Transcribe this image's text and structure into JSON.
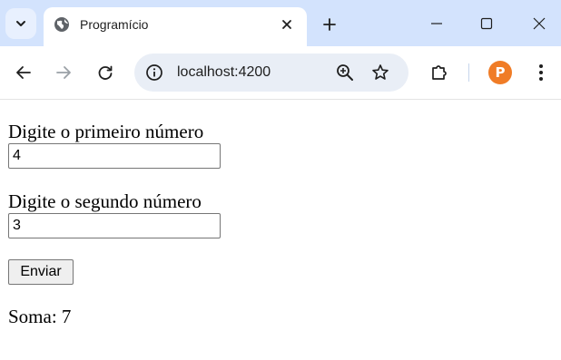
{
  "browser": {
    "tab": {
      "title": "Programício",
      "favicon": "globe-icon"
    },
    "address_bar": {
      "url": "localhost:4200"
    },
    "profile_avatar_letter": "P",
    "colors": {
      "tabstrip": "#d3e3fd",
      "omnibox": "#e9eef6",
      "avatar": "#f07c26"
    }
  },
  "form": {
    "first": {
      "label": "Digite o primeiro número",
      "value": "4"
    },
    "second": {
      "label": "Digite o segundo número",
      "value": "3"
    },
    "submit_label": "Enviar",
    "result_label": "Soma:",
    "result_value": "7"
  }
}
